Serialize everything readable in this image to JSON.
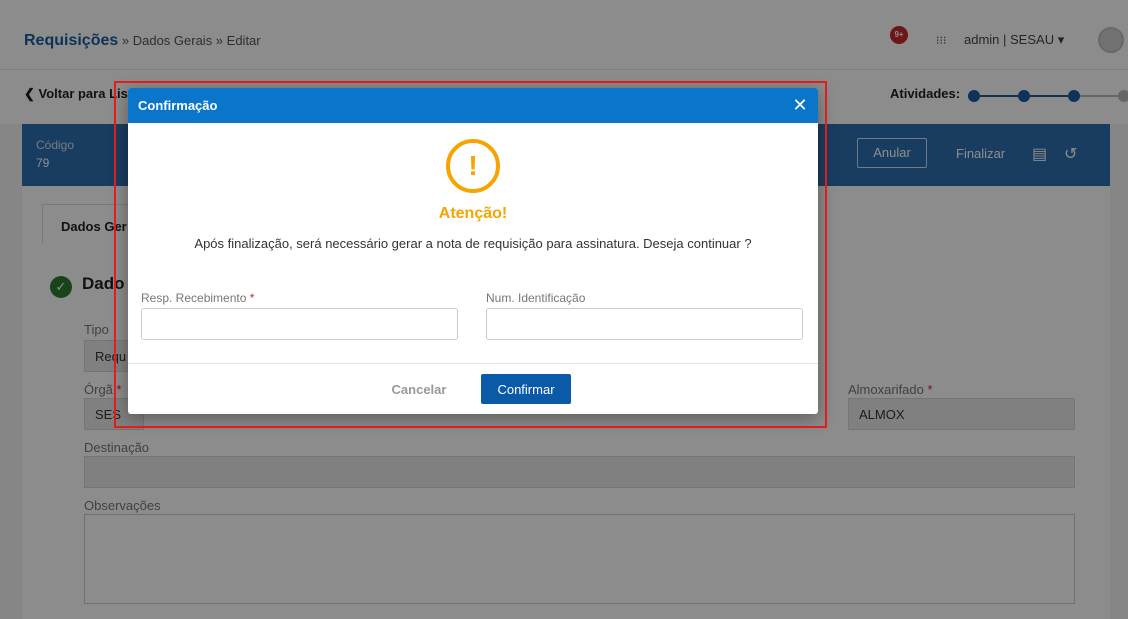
{
  "topbar": {
    "breadcrumb_main": "Requisições",
    "breadcrumb_rest": " » Dados Gerais » Editar",
    "notification_count": "9+",
    "apps_icon": "grid-icon",
    "user_label": "admin | SESAU ▾"
  },
  "subbar": {
    "back_label": "❮ Voltar para Lis",
    "activities_label": "Atividades:"
  },
  "header_band": {
    "code_label": "Código",
    "code_value": "79",
    "anular_label": "Anular",
    "finalizar_label": "Finalizar"
  },
  "content": {
    "tab_label": "Dados Ger",
    "section_title": "Dado",
    "tipo_label": "Tipo",
    "tipo_value": "Requ",
    "orgao_label": "Órgã",
    "orgao_value": "SES",
    "almoxarifado_label": "Almoxarifado",
    "almoxarifado_value": "ALMOX",
    "destinacao_label": "Destinação",
    "observacoes_label": "Observações"
  },
  "modal": {
    "title": "Confirmação",
    "close_glyph": "✕",
    "warning_glyph": "!",
    "warning_title": "Atenção!",
    "message": "Após finalização, será necessário gerar a nota de requisição para assinatura. Deseja continuar ?",
    "resp_label": "Resp. Recebimento",
    "resp_value": "",
    "num_label": "Num. Identificação",
    "num_value": "",
    "required_mark": "*",
    "cancel_label": "Cancelar",
    "confirm_label": "Confirmar"
  },
  "colors": {
    "modal_header": "#0a76c9",
    "warning": "#f5a400",
    "confirm_button": "#0a5aa8",
    "highlight_border": "#e01e1e"
  }
}
